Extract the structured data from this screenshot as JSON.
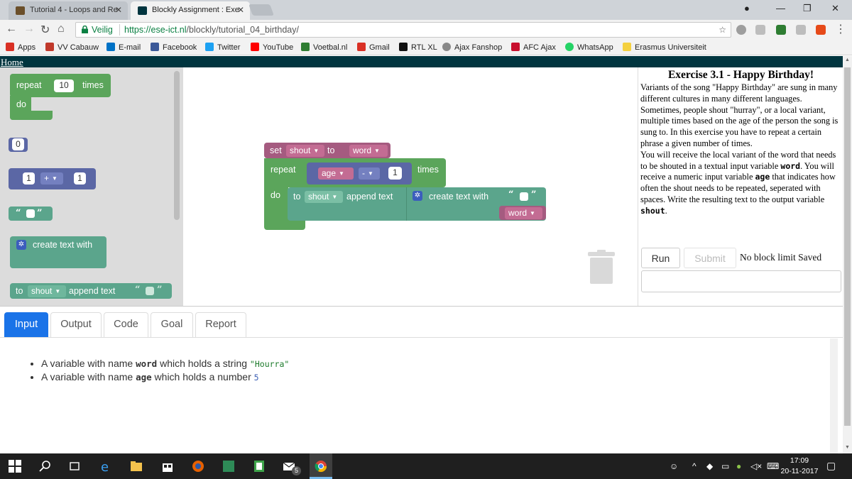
{
  "browser": {
    "tabs": [
      {
        "title": "Tutorial 4 - Loops and Re",
        "active": false
      },
      {
        "title": "Blockly Assignment : Exe",
        "active": true
      }
    ],
    "security_label": "Veilig",
    "url_base": "https://ese-ict.nl",
    "url_path": "/blockly/tutorial_04_birthday/"
  },
  "bookmarks": [
    {
      "label": "Apps",
      "color": "#d93025"
    },
    {
      "label": "VV Cabauw",
      "color": "#c0392b"
    },
    {
      "label": "E-mail",
      "color": "#0072c6"
    },
    {
      "label": "Facebook",
      "color": "#3b5998"
    },
    {
      "label": "Twitter",
      "color": "#1da1f2"
    },
    {
      "label": "YouTube",
      "color": "#ff0000"
    },
    {
      "label": "Voetbal.nl",
      "color": "#2e7d32"
    },
    {
      "label": "Gmail",
      "color": "#d93025"
    },
    {
      "label": "RTL XL",
      "color": "#111111"
    },
    {
      "label": "Ajax Fanshop",
      "color": "#888888"
    },
    {
      "label": "AFC Ajax",
      "color": "#c8102e"
    },
    {
      "label": "WhatsApp",
      "color": "#25d366"
    },
    {
      "label": "Erasmus Universiteit",
      "color": "#f4d03f"
    }
  ],
  "page": {
    "home_link": "Home"
  },
  "toolbox": {
    "repeat_block": {
      "repeat": "repeat",
      "count": "10",
      "times": "times",
      "do": "do"
    },
    "number_block": "0",
    "arith_block": {
      "left": "1",
      "op": "+",
      "right": "1"
    },
    "text_block": {
      "open": "“",
      "close": "”"
    },
    "create_text": "create text with",
    "append_block": {
      "to": "to",
      "var": "shout",
      "append": "append text"
    }
  },
  "workspace": {
    "set_block": {
      "set": "set",
      "var": "shout",
      "to": "to",
      "value": "word"
    },
    "repeat_block": {
      "repeat": "repeat",
      "var": "age",
      "op": "-",
      "num": "1",
      "times": "times",
      "do": "do"
    },
    "append_block": {
      "to": "to",
      "var": "shout",
      "append": "append text"
    },
    "create_text": "create text with",
    "item_var": "word"
  },
  "exercise": {
    "title": "Exercise 3.1 - Happy Birthday!",
    "para1": "Variants of the song \"Happy Birthday\" are sung in many different cultures in many different languages. Sometimes, people shout \"hurray\", or a local variant, multiple times based on the age of the person the song is sung to. In this exercise you have to repeat a certain phrase a given number of times.",
    "para2_a": "You will receive the local variant of the word that needs to be shouted in a textual input variable ",
    "para2_word": "word",
    "para2_b": ". You will receive a numeric input variable ",
    "para2_age": "age",
    "para2_c": " that indicates how often the shout needs to be repeated, seperated with spaces. Write the resulting text to the output variable ",
    "para2_shout": "shout",
    "para2_d": ".",
    "run_label": "Run",
    "submit_label": "Submit",
    "status": "No block limit Saved"
  },
  "bottom_tabs": [
    "Input",
    "Output",
    "Code",
    "Goal",
    "Report"
  ],
  "input_pane": {
    "item1_a": "A variable with name ",
    "item1_var": "word",
    "item1_b": " which holds a string ",
    "item1_val": "\"Hourra\"",
    "item2_a": "A variable with name ",
    "item2_var": "age",
    "item2_b": " which holds a number ",
    "item2_val": "5"
  },
  "taskbar": {
    "time": "17:09",
    "date": "20-11-2017",
    "mail_badge": "5"
  }
}
